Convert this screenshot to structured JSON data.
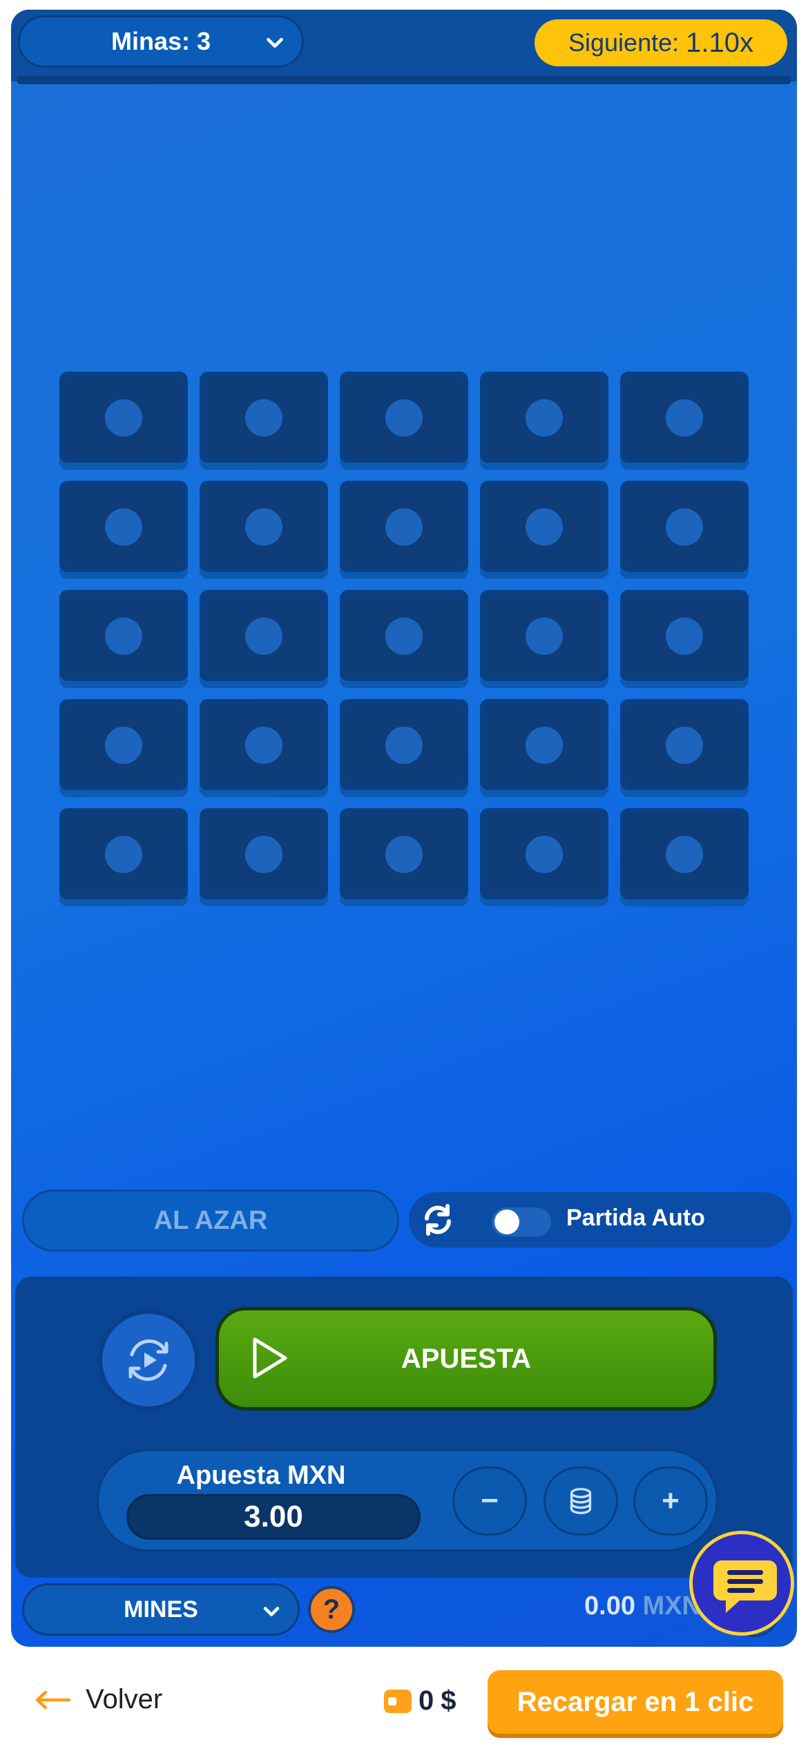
{
  "header": {
    "mines_select_label": "Minas: 3",
    "next_label": "Siguiente:",
    "next_multiplier": "1.10x"
  },
  "grid": {
    "rows": 5,
    "columns": 5
  },
  "controls": {
    "random_label": "AL AZAR",
    "auto_play_label": "Partida Auto",
    "auto_play_enabled": false,
    "bet_button_label": "APUESTA",
    "stake_label": "Apuesta MXN",
    "stake_value": "3.00",
    "minus_label": "−",
    "plus_label": "+"
  },
  "footer_game": {
    "game_select_label": "MINES",
    "help_label": "?",
    "balance_value": "0.00",
    "balance_currency": "MXN"
  },
  "bottom_bar": {
    "back_label": "Volver",
    "wallet_amount": "0",
    "wallet_currency": "$",
    "recharge_label": "Recargar en 1 clic"
  },
  "colors": {
    "accent_yellow": "#ffc30a",
    "bet_green": "#4c9c0e",
    "recharge_orange": "#ffa311",
    "game_blue": "#1470e0"
  }
}
